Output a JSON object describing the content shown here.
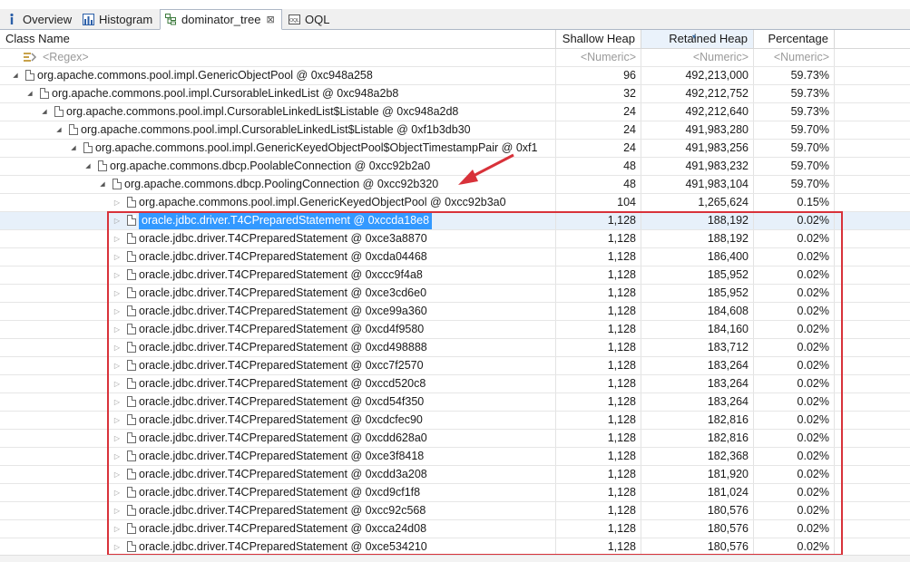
{
  "tabs": [
    {
      "label": "Overview",
      "icon": "info-icon",
      "active": false
    },
    {
      "label": "Histogram",
      "icon": "histogram-icon",
      "active": false
    },
    {
      "label": "dominator_tree",
      "icon": "tree-icon",
      "active": true,
      "close": "⊠"
    },
    {
      "label": "OQL",
      "icon": "oql-icon",
      "active": false
    }
  ],
  "columns": {
    "class_name": "Class Name",
    "shallow_heap": "Shallow Heap",
    "retained_heap": "Retained Heap",
    "percentage": "Percentage"
  },
  "filter_row": {
    "regex": "<Regex>",
    "shallow": "<Numeric>",
    "retained": "<Numeric>",
    "percentage": "<Numeric>"
  },
  "rows": [
    {
      "name": "org.apache.commons.pool.impl.GenericObjectPool @ 0xc948a258",
      "shallow": "96",
      "retained": "492,213,000",
      "pct": "59.73%"
    },
    {
      "name": "org.apache.commons.pool.impl.CursorableLinkedList @ 0xc948a2b8",
      "shallow": "32",
      "retained": "492,212,752",
      "pct": "59.73%"
    },
    {
      "name": "org.apache.commons.pool.impl.CursorableLinkedList$Listable @ 0xc948a2d8",
      "shallow": "24",
      "retained": "492,212,640",
      "pct": "59.73%"
    },
    {
      "name": "org.apache.commons.pool.impl.CursorableLinkedList$Listable @ 0xf1b3db30",
      "shallow": "24",
      "retained": "491,983,280",
      "pct": "59.70%"
    },
    {
      "name": "org.apache.commons.pool.impl.GenericKeyedObjectPool$ObjectTimestampPair @ 0xf1",
      "shallow": "24",
      "retained": "491,983,256",
      "pct": "59.70%"
    },
    {
      "name": "org.apache.commons.dbcp.PoolableConnection @ 0xcc92b2a0",
      "shallow": "48",
      "retained": "491,983,232",
      "pct": "59.70%"
    },
    {
      "name": "org.apache.commons.dbcp.PoolingConnection @ 0xcc92b320",
      "shallow": "48",
      "retained": "491,983,104",
      "pct": "59.70%"
    },
    {
      "name": "org.apache.commons.pool.impl.GenericKeyedObjectPool @ 0xcc92b3a0",
      "shallow": "104",
      "retained": "1,265,624",
      "pct": "0.15%"
    },
    {
      "name": "oracle.jdbc.driver.T4CPreparedStatement @ 0xccda18e8",
      "shallow": "1,128",
      "retained": "188,192",
      "pct": "0.02%"
    },
    {
      "name": "oracle.jdbc.driver.T4CPreparedStatement @ 0xce3a8870",
      "shallow": "1,128",
      "retained": "188,192",
      "pct": "0.02%"
    },
    {
      "name": "oracle.jdbc.driver.T4CPreparedStatement @ 0xcda04468",
      "shallow": "1,128",
      "retained": "186,400",
      "pct": "0.02%"
    },
    {
      "name": "oracle.jdbc.driver.T4CPreparedStatement @ 0xccc9f4a8",
      "shallow": "1,128",
      "retained": "185,952",
      "pct": "0.02%"
    },
    {
      "name": "oracle.jdbc.driver.T4CPreparedStatement @ 0xce3cd6e0",
      "shallow": "1,128",
      "retained": "185,952",
      "pct": "0.02%"
    },
    {
      "name": "oracle.jdbc.driver.T4CPreparedStatement @ 0xce99a360",
      "shallow": "1,128",
      "retained": "184,608",
      "pct": "0.02%"
    },
    {
      "name": "oracle.jdbc.driver.T4CPreparedStatement @ 0xcd4f9580",
      "shallow": "1,128",
      "retained": "184,160",
      "pct": "0.02%"
    },
    {
      "name": "oracle.jdbc.driver.T4CPreparedStatement @ 0xcd498888",
      "shallow": "1,128",
      "retained": "183,712",
      "pct": "0.02%"
    },
    {
      "name": "oracle.jdbc.driver.T4CPreparedStatement @ 0xcc7f2570",
      "shallow": "1,128",
      "retained": "183,264",
      "pct": "0.02%"
    },
    {
      "name": "oracle.jdbc.driver.T4CPreparedStatement @ 0xccd520c8",
      "shallow": "1,128",
      "retained": "183,264",
      "pct": "0.02%"
    },
    {
      "name": "oracle.jdbc.driver.T4CPreparedStatement @ 0xcd54f350",
      "shallow": "1,128",
      "retained": "183,264",
      "pct": "0.02%"
    },
    {
      "name": "oracle.jdbc.driver.T4CPreparedStatement @ 0xcdcfec90",
      "shallow": "1,128",
      "retained": "182,816",
      "pct": "0.02%"
    },
    {
      "name": "oracle.jdbc.driver.T4CPreparedStatement @ 0xcdd628a0",
      "shallow": "1,128",
      "retained": "182,816",
      "pct": "0.02%"
    },
    {
      "name": "oracle.jdbc.driver.T4CPreparedStatement @ 0xce3f8418",
      "shallow": "1,128",
      "retained": "182,368",
      "pct": "0.02%"
    },
    {
      "name": "oracle.jdbc.driver.T4CPreparedStatement @ 0xcdd3a208",
      "shallow": "1,128",
      "retained": "181,920",
      "pct": "0.02%"
    },
    {
      "name": "oracle.jdbc.driver.T4CPreparedStatement @ 0xcd9cf1f8",
      "shallow": "1,128",
      "retained": "181,024",
      "pct": "0.02%"
    },
    {
      "name": "oracle.jdbc.driver.T4CPreparedStatement @ 0xcc92c568",
      "shallow": "1,128",
      "retained": "180,576",
      "pct": "0.02%"
    },
    {
      "name": "oracle.jdbc.driver.T4CPreparedStatement @ 0xcca24d08",
      "shallow": "1,128",
      "retained": "180,576",
      "pct": "0.02%"
    },
    {
      "name": "oracle.jdbc.driver.T4CPreparedStatement @ 0xce534210",
      "shallow": "1,128",
      "retained": "180,576",
      "pct": "0.02%"
    }
  ],
  "colors": {
    "selection": "#3399ff",
    "annotation": "#d8323a"
  }
}
